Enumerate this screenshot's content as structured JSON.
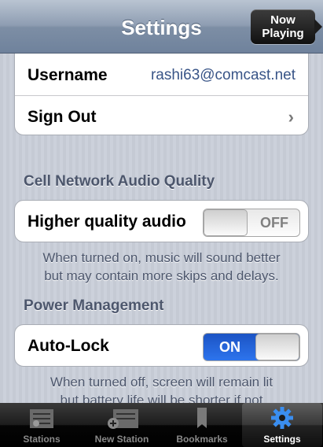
{
  "navbar": {
    "title": "Settings",
    "now_playing_line1": "Now",
    "now_playing_line2": "Playing"
  },
  "account": {
    "username_label": "Username",
    "username_value": "rashi63@comcast.net",
    "sign_out_label": "Sign Out",
    "chevron": "›"
  },
  "audio": {
    "section_title": "Cell Network Audio Quality",
    "row_label": "Higher quality audio",
    "toggle_state": "OFF",
    "footnote_line1": "When turned on, music will sound better",
    "footnote_line2": "but may contain more skips and delays."
  },
  "power": {
    "section_title": "Power Management",
    "row_label": "Auto-Lock",
    "toggle_state": "ON",
    "footnote_line1": "When turned off, screen will remain lit",
    "footnote_line2": "but battery life will be shorter if not"
  },
  "tabbar": {
    "items": [
      {
        "label": "Stations",
        "icon": "stations-icon",
        "active": false
      },
      {
        "label": "New Station",
        "icon": "new-station-icon",
        "active": false
      },
      {
        "label": "Bookmarks",
        "icon": "bookmark-icon",
        "active": false
      },
      {
        "label": "Settings",
        "icon": "gear-icon",
        "active": true
      }
    ]
  },
  "colors": {
    "accent_blue": "#2d6ae6",
    "value_blue": "#385487",
    "section_text": "#4c566c"
  }
}
